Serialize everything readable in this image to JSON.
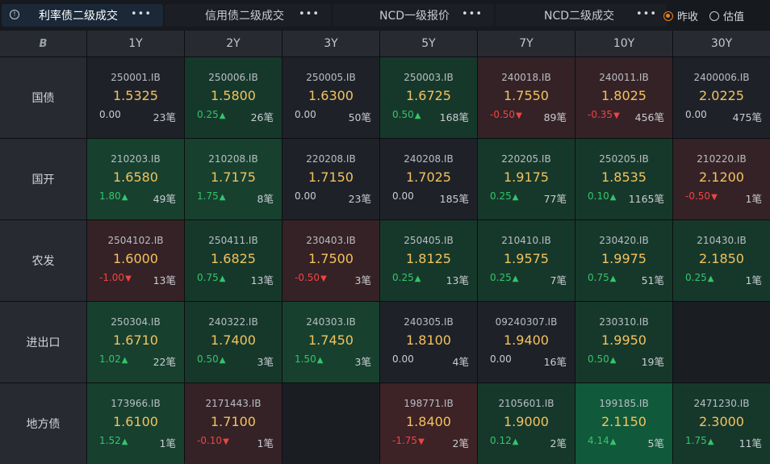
{
  "tabs": [
    {
      "label": "利率债二级成交",
      "active": true
    },
    {
      "label": "信用债二级成交",
      "active": false
    },
    {
      "label": "NCD一级报价",
      "active": false
    },
    {
      "label": "NCD二级成交",
      "active": false
    }
  ],
  "more_label": "•••",
  "radios": [
    {
      "label": "昨收",
      "selected": true
    },
    {
      "label": "估值",
      "selected": false
    }
  ],
  "corner_logo": "B",
  "columns": [
    "1Y",
    "2Y",
    "3Y",
    "5Y",
    "7Y",
    "10Y",
    "30Y"
  ],
  "rows": [
    {
      "label": "国债",
      "cells": [
        {
          "code": "250001.IB",
          "yield": "1.5325",
          "chg": "0.00",
          "dir": "flat",
          "count": "23笔",
          "tone": "neutral"
        },
        {
          "code": "250006.IB",
          "yield": "1.5800",
          "chg": "0.25",
          "dir": "up",
          "count": "26笔",
          "tone": "green"
        },
        {
          "code": "250005.IB",
          "yield": "1.6300",
          "chg": "0.00",
          "dir": "flat",
          "count": "50笔",
          "tone": "neutral"
        },
        {
          "code": "250003.IB",
          "yield": "1.6725",
          "chg": "0.50",
          "dir": "up",
          "count": "168笔",
          "tone": "green"
        },
        {
          "code": "240018.IB",
          "yield": "1.7550",
          "chg": "-0.50",
          "dir": "down",
          "count": "89笔",
          "tone": "red"
        },
        {
          "code": "240011.IB",
          "yield": "1.8025",
          "chg": "-0.35",
          "dir": "down",
          "count": "456笔",
          "tone": "red"
        },
        {
          "code": "2400006.IB",
          "yield": "2.0225",
          "chg": "0.00",
          "dir": "flat",
          "count": "475笔",
          "tone": "neutral"
        }
      ]
    },
    {
      "label": "国开",
      "cells": [
        {
          "code": "210203.IB",
          "yield": "1.6580",
          "chg": "1.80",
          "dir": "up",
          "count": "49笔",
          "tone": "green2"
        },
        {
          "code": "210208.IB",
          "yield": "1.7175",
          "chg": "1.75",
          "dir": "up",
          "count": "8笔",
          "tone": "green2"
        },
        {
          "code": "220208.IB",
          "yield": "1.7150",
          "chg": "0.00",
          "dir": "flat",
          "count": "23笔",
          "tone": "neutral"
        },
        {
          "code": "240208.IB",
          "yield": "1.7025",
          "chg": "0.00",
          "dir": "flat",
          "count": "185笔",
          "tone": "neutral"
        },
        {
          "code": "220205.IB",
          "yield": "1.9175",
          "chg": "0.25",
          "dir": "up",
          "count": "77笔",
          "tone": "green"
        },
        {
          "code": "250205.IB",
          "yield": "1.8535",
          "chg": "0.10",
          "dir": "up",
          "count": "1165笔",
          "tone": "green"
        },
        {
          "code": "210220.IB",
          "yield": "2.1200",
          "chg": "-0.50",
          "dir": "down",
          "count": "1笔",
          "tone": "red"
        }
      ]
    },
    {
      "label": "农发",
      "cells": [
        {
          "code": "2504102.IB",
          "yield": "1.6000",
          "chg": "-1.00",
          "dir": "down",
          "count": "13笔",
          "tone": "red"
        },
        {
          "code": "250411.IB",
          "yield": "1.6825",
          "chg": "0.75",
          "dir": "up",
          "count": "13笔",
          "tone": "green"
        },
        {
          "code": "230403.IB",
          "yield": "1.7500",
          "chg": "-0.50",
          "dir": "down",
          "count": "3笔",
          "tone": "red"
        },
        {
          "code": "250405.IB",
          "yield": "1.8125",
          "chg": "0.25",
          "dir": "up",
          "count": "13笔",
          "tone": "green"
        },
        {
          "code": "210410.IB",
          "yield": "1.9575",
          "chg": "0.25",
          "dir": "up",
          "count": "7笔",
          "tone": "green"
        },
        {
          "code": "230420.IB",
          "yield": "1.9975",
          "chg": "0.75",
          "dir": "up",
          "count": "51笔",
          "tone": "green"
        },
        {
          "code": "210430.IB",
          "yield": "2.1850",
          "chg": "0.25",
          "dir": "up",
          "count": "1笔",
          "tone": "green"
        }
      ]
    },
    {
      "label": "进出口",
      "cells": [
        {
          "code": "250304.IB",
          "yield": "1.6710",
          "chg": "1.02",
          "dir": "up",
          "count": "22笔",
          "tone": "green2"
        },
        {
          "code": "240322.IB",
          "yield": "1.7400",
          "chg": "0.50",
          "dir": "up",
          "count": "3笔",
          "tone": "green"
        },
        {
          "code": "240303.IB",
          "yield": "1.7450",
          "chg": "1.50",
          "dir": "up",
          "count": "3笔",
          "tone": "green2"
        },
        {
          "code": "240305.IB",
          "yield": "1.8100",
          "chg": "0.00",
          "dir": "flat",
          "count": "4笔",
          "tone": "neutral"
        },
        {
          "code": "09240307.IB",
          "yield": "1.9400",
          "chg": "0.00",
          "dir": "flat",
          "count": "16笔",
          "tone": "neutral"
        },
        {
          "code": "230310.IB",
          "yield": "1.9950",
          "chg": "0.50",
          "dir": "up",
          "count": "19笔",
          "tone": "green"
        },
        null
      ]
    },
    {
      "label": "地方债",
      "cells": [
        {
          "code": "173966.IB",
          "yield": "1.6100",
          "chg": "1.52",
          "dir": "up",
          "count": "1笔",
          "tone": "green2"
        },
        {
          "code": "2171443.IB",
          "yield": "1.7100",
          "chg": "-0.10",
          "dir": "down",
          "count": "1笔",
          "tone": "red"
        },
        null,
        {
          "code": "198771.IB",
          "yield": "1.8400",
          "chg": "-1.75",
          "dir": "down",
          "count": "2笔",
          "tone": "red2"
        },
        {
          "code": "2105601.IB",
          "yield": "1.9000",
          "chg": "0.12",
          "dir": "up",
          "count": "2笔",
          "tone": "green"
        },
        {
          "code": "199185.IB",
          "yield": "2.1150",
          "chg": "4.14",
          "dir": "up",
          "count": "5笔",
          "tone": "green3"
        },
        {
          "code": "2471230.IB",
          "yield": "2.3000",
          "chg": "1.75",
          "dir": "up",
          "count": "11笔",
          "tone": "green"
        }
      ]
    }
  ]
}
